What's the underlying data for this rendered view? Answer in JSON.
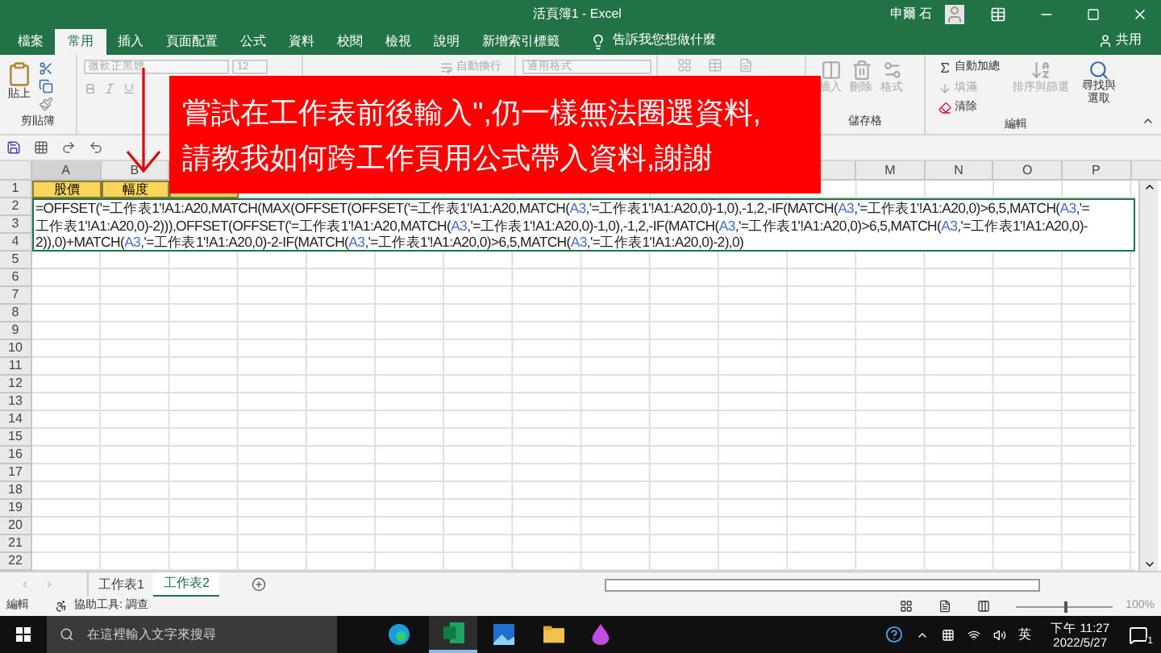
{
  "window": {
    "title": "活頁簿1 - Excel",
    "user": "申爾 石"
  },
  "ribbon_tabs": [
    {
      "label": "檔案",
      "selected": false
    },
    {
      "label": "常用",
      "selected": true
    },
    {
      "label": "插入",
      "selected": false
    },
    {
      "label": "頁面配置",
      "selected": false
    },
    {
      "label": "公式",
      "selected": false
    },
    {
      "label": "資料",
      "selected": false
    },
    {
      "label": "校閱",
      "selected": false
    },
    {
      "label": "檢視",
      "selected": false
    },
    {
      "label": "說明",
      "selected": false
    },
    {
      "label": "新增索引標籤",
      "selected": false
    }
  ],
  "tell_me": "告訴我您想做什麼",
  "share": "共用",
  "ribbon": {
    "paste": "貼上",
    "clipboard_group": "剪貼簿",
    "font_name": "微軟正黑體",
    "font_size": "12",
    "wrap_text": "自動換行",
    "number_format": "通用格式",
    "cells_buttons": [
      "插入",
      "刪除",
      "格式"
    ],
    "cells_group": "儲存格",
    "autosum": "自動加總",
    "fill": "填滿",
    "clear": "清除",
    "sort_filter": "排序與篩選",
    "find_select": [
      "尋找與",
      "選取"
    ],
    "editing_group": "編輯"
  },
  "annotation": {
    "lines": [
      "嘗試在工作表前後輸入'',仍一樣無法圈選資料,",
      "請教我如何跨工作頁用公式帶入資料,謝謝"
    ]
  },
  "column_headers_left": [
    "A",
    "B"
  ],
  "column_headers_right": [
    "M",
    "N",
    "O",
    "P"
  ],
  "row_1_cells": [
    "股價",
    "幅度"
  ],
  "formula_lines": [
    [
      {
        "kind": "text",
        "text": "=OFFSET('=工作表1'!A1:A20,MATCH(MAX(OFFSET(OFFSET('=工作表1'!A1:A20,MATCH("
      },
      {
        "kind": "ref",
        "text": "A3"
      },
      {
        "kind": "text",
        "text": ",'=工作表1'!A1:A20,0)-1,0),-1,2,-IF(MATCH("
      },
      {
        "kind": "ref",
        "text": "A3"
      },
      {
        "kind": "text",
        "text": ",'=工作表1'!A1:A20,0)>6,5,MATCH("
      },
      {
        "kind": "ref",
        "text": "A3"
      },
      {
        "kind": "text",
        "text": ",'="
      }
    ],
    [
      {
        "kind": "text",
        "text": "工作表1'!A1:A20,0)-2))),OFFSET(OFFSET('=工作表1'!A1:A20,MATCH("
      },
      {
        "kind": "ref",
        "text": "A3"
      },
      {
        "kind": "text",
        "text": ",'=工作表1'!A1:A20,0)-1,0),-1,2,-IF(MATCH("
      },
      {
        "kind": "ref",
        "text": "A3"
      },
      {
        "kind": "text",
        "text": ",'=工作表1'!A1:A20,0)>6,5,MATCH("
      },
      {
        "kind": "ref",
        "text": "A3"
      },
      {
        "kind": "text",
        "text": ",'=工作表1'!A1:A20,0)-"
      }
    ],
    [
      {
        "kind": "text",
        "text": "2)),0)+MATCH("
      },
      {
        "kind": "ref",
        "text": "A3"
      },
      {
        "kind": "text",
        "text": ",'=工作表1'!A1:A20,0)-2-IF(MATCH("
      },
      {
        "kind": "ref",
        "text": "A3"
      },
      {
        "kind": "text",
        "text": ",'=工作表1'!A1:A20,0)>6,5,MATCH("
      },
      {
        "kind": "ref",
        "text": "A3"
      },
      {
        "kind": "text",
        "text": ",'=工作表1'!A1:A20,0)-2),0)"
      }
    ]
  ],
  "row_numbers": [
    "1",
    "2",
    "3",
    "4",
    "5",
    "6",
    "7",
    "8",
    "9",
    "10",
    "11",
    "12",
    "13",
    "14",
    "15",
    "16",
    "17",
    "18",
    "19",
    "20",
    "21",
    "22"
  ],
  "sheet_tabs": [
    {
      "label": "工作表1",
      "selected": false
    },
    {
      "label": "工作表2",
      "selected": true
    }
  ],
  "status_bar": {
    "mode": "編輯",
    "accessibility": "協助工具: 調查",
    "zoom": "100%",
    "level": 0.5
  },
  "taskbar": {
    "search_placeholder": "在這裡輸入文字來搜尋",
    "input_language": "英",
    "time": "下午 11:27",
    "date": "2022/5/27",
    "notification_count": "1"
  }
}
